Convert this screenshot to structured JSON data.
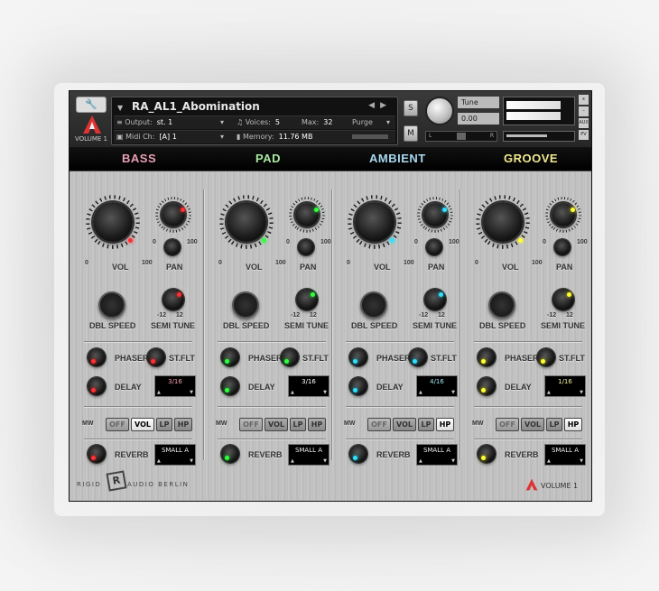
{
  "header": {
    "instrument_name": "RA_AL1_Abomination",
    "logo_text": "VOLUME 1",
    "output_label": "Output:",
    "output_value": "st. 1",
    "voices_label": "Voices:",
    "voices_value": "5",
    "max_label": "Max:",
    "max_value": "32",
    "purge_label": "Purge",
    "midi_label": "Midi Ch:",
    "midi_value": "[A]  1",
    "memory_label": "Memory:",
    "memory_value": "11.76 MB",
    "solo_label": "S",
    "mute_label": "M",
    "tune_label": "Tune",
    "tune_value": "0.00",
    "pan_l": "L",
    "pan_r": "R",
    "side_close": "x",
    "side_minus": "–",
    "side_aux": "AUX",
    "side_pv": "PV"
  },
  "tabs": [
    {
      "label": "BASS",
      "color": "#e8a0b4"
    },
    {
      "label": "PAD",
      "color": "#a8e8a0"
    },
    {
      "label": "AMBIENT",
      "color": "#a8d8f0"
    },
    {
      "label": "GROOVE",
      "color": "#f0e890"
    }
  ],
  "labels": {
    "vol": "VOL",
    "pan": "PAN",
    "zero": "0",
    "hundred": "100",
    "dbl_speed": "DBL SPEED",
    "semi_tune": "SEMI TUNE",
    "neg12": "-12",
    "pos12": "12",
    "phaser": "PHASER",
    "st_flt": "ST.FLT",
    "delay": "DELAY",
    "mw": "MW",
    "off": "OFF",
    "vol_btn": "VOL",
    "lp": "LP",
    "hp": "HP",
    "reverb": "REVERB",
    "reverb_type": "SMALL A"
  },
  "channels": [
    {
      "delay_value": "3/16",
      "delay_color": "#f0a0b0",
      "led_color": "#ff3030",
      "mw_selected": "VOL"
    },
    {
      "delay_value": "3/16",
      "delay_color": "#ffffff",
      "led_color": "#30ff40",
      "mw_selected": "none"
    },
    {
      "delay_value": "4/16",
      "delay_color": "#a0e8f0",
      "led_color": "#30e0ff",
      "mw_selected": "HP"
    },
    {
      "delay_value": "1/16",
      "delay_color": "#f0f0a0",
      "led_color": "#ffff30",
      "mw_selected": "HP"
    }
  ],
  "footer": {
    "brand_left": "RIGID",
    "brand_right": "AUDIO BERLIN",
    "brand_logo": "R",
    "volume": "VOLUME 1"
  }
}
